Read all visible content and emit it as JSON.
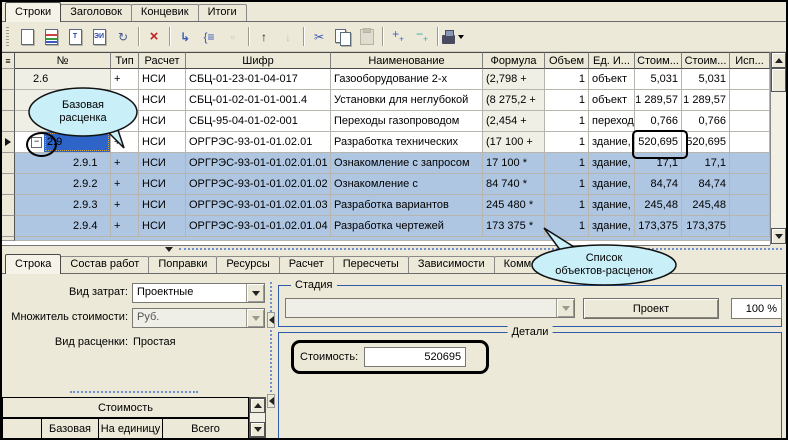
{
  "top_tabs": {
    "active_index": 0,
    "items": [
      {
        "label": "Строки"
      },
      {
        "label": "Заголовок"
      },
      {
        "label": "Концевик"
      },
      {
        "label": "Итоги"
      }
    ]
  },
  "toolbar": {
    "buttons": [
      {
        "kind": "page",
        "name": "add-line-button",
        "icon": "new-page-icon"
      },
      {
        "kind": "page-color",
        "name": "add-line-copy-button",
        "icon": "new-page-color-icon"
      },
      {
        "kind": "page",
        "label": "Т",
        "name": "add-title-line-button",
        "icon": "page-title-icon"
      },
      {
        "kind": "page",
        "label": "ЭИ",
        "name": "add-nsi-line-button",
        "icon": "page-nsi-icon"
      },
      {
        "kind": "glyph",
        "glyph": "↻",
        "color": "#44588c",
        "name": "renumber-lines-button",
        "icon": "renumber-icon"
      },
      {
        "kind": "divider"
      },
      {
        "kind": "glyph",
        "glyph": "×",
        "color": "#c22222",
        "bold": true,
        "size": 15,
        "name": "delete-line-button",
        "icon": "red-x-icon"
      },
      {
        "kind": "divider"
      },
      {
        "kind": "glyph",
        "glyph": "↳",
        "color": "#3a58b8",
        "bold": true,
        "name": "add-sub-lines-button",
        "icon": "sub-lines-icon"
      },
      {
        "kind": "glyph",
        "glyph": "{≡",
        "color": "#3a58b8",
        "name": "group-lines-button",
        "icon": "brace-group-icon"
      },
      {
        "kind": "glyph",
        "glyph": "▫",
        "color": "#a8a8a0",
        "disabled": true,
        "name": "ungroup-lines-button",
        "icon": "ungroup-icon"
      },
      {
        "kind": "divider"
      },
      {
        "kind": "glyph",
        "glyph": "↑",
        "color": "#222222",
        "bold": true,
        "name": "move-line-up-button",
        "icon": "arrow-up-icon"
      },
      {
        "kind": "glyph",
        "glyph": "↓",
        "color": "#9aa4b8",
        "bold": true,
        "disabled": true,
        "name": "move-line-down-button",
        "icon": "arrow-down-icon"
      },
      {
        "kind": "divider"
      },
      {
        "kind": "glyph",
        "glyph": "✂",
        "color": "#3a58b8",
        "name": "cut-button",
        "icon": "scissors-icon"
      },
      {
        "kind": "copy",
        "name": "copy-button",
        "icon": "copy-pages-icon"
      },
      {
        "kind": "paste",
        "disabled": true,
        "name": "paste-button",
        "icon": "clipboard-paste-icon"
      },
      {
        "kind": "divider"
      },
      {
        "kind": "glyph2",
        "glyph": "+",
        "sub": "+",
        "color": "#3a5fd0",
        "name": "include-lines-button",
        "icon": "plus-plus-icon"
      },
      {
        "kind": "glyph2",
        "glyph": "−",
        "sub": "+",
        "color": "#2aa8a8",
        "name": "exclude-lines-button",
        "icon": "minus-plus-icon"
      },
      {
        "kind": "divider"
      },
      {
        "kind": "bucket",
        "dropdown": true,
        "name": "fill-print-button",
        "icon": "ink-bucket-icon"
      }
    ]
  },
  "grid": {
    "columns": [
      "№",
      "Тип",
      "Расчет",
      "Шифр",
      "Наименование",
      "Формула",
      "Объем",
      "Ед. И...",
      "Стоим...",
      "Стоим...",
      "Исп..."
    ],
    "rows": [
      {
        "num": "2.6",
        "type": "+",
        "calc": "НСИ",
        "code": "СБЦ-01-23-01-04-017",
        "name": "Газооборудование 2-х",
        "formula": "(2,798 +",
        "volume": "1",
        "unit": "объект",
        "cost1": "5,031",
        "cost2": "5,031",
        "usage": ""
      },
      {
        "num": "",
        "type": "",
        "calc": "НСИ",
        "code": "СБЦ-01-02-01-01-001.4",
        "name": "Установки для неглубокой",
        "formula": "(8 275,2 +",
        "volume": "1",
        "unit": "объект",
        "cost1": "1 289,57",
        "cost2": "1 289,57",
        "usage": ""
      },
      {
        "num": "",
        "type": "",
        "calc": "НСИ",
        "code": "СБЦ-95-04-01-02-001",
        "name": "Переходы газопроводом",
        "formula": "(2,454 +",
        "volume": "1",
        "unit": "переход",
        "cost1": "0,766",
        "cost2": "0,766",
        "usage": ""
      },
      {
        "num": "2.9",
        "type": "+",
        "calc": "НСИ",
        "code": "ОРГРЭС-93-01-01.02.01",
        "name": "Разработка технических",
        "formula": "(17 100 +",
        "volume": "1",
        "unit": "здание,",
        "cost1": "520,695",
        "cost2": "520,695",
        "usage": "",
        "current": true,
        "expander": "minus",
        "marker": true
      },
      {
        "num": "2.9.1",
        "type": "+",
        "calc": "НСИ",
        "code": "ОРГРЭС-93-01-01.02.01.01",
        "name": "Ознакомление с запросом",
        "formula": "17 100 *",
        "volume": "1",
        "unit": "здание,",
        "cost1": "17,1",
        "cost2": "17,1",
        "usage": "",
        "child": true
      },
      {
        "num": "2.9.2",
        "type": "+",
        "calc": "НСИ",
        "code": "ОРГРЭС-93-01-01.02.01.02",
        "name": "Ознакомление с",
        "formula": "84 740 *",
        "volume": "1",
        "unit": "здание,",
        "cost1": "84,74",
        "cost2": "84,74",
        "usage": "",
        "child": true
      },
      {
        "num": "2.9.3",
        "type": "+",
        "calc": "НСИ",
        "code": "ОРГРЭС-93-01-01.02.01.03",
        "name": "Разработка вариантов",
        "formula": "245 480 *",
        "volume": "1",
        "unit": "здание,",
        "cost1": "245,48",
        "cost2": "245,48",
        "usage": "",
        "child": true
      },
      {
        "num": "2.9.4",
        "type": "+",
        "calc": "НСИ",
        "code": "ОРГРЭС-93-01-01.02.01.04",
        "name": "Разработка чертежей",
        "formula": "173 375 *",
        "volume": "1",
        "unit": "здание,",
        "cost1": "173,375",
        "cost2": "173,375",
        "usage": "",
        "child": true
      }
    ],
    "partial_next_row": true
  },
  "callouts": {
    "base_rate": "Базовая\nрасценка",
    "object_list": "Список\nобъектов-расценок"
  },
  "bottom_tabs": {
    "active_index": 0,
    "items": [
      {
        "label": "Строка"
      },
      {
        "label": "Состав работ"
      },
      {
        "label": "Поправки"
      },
      {
        "label": "Ресурсы"
      },
      {
        "label": "Расчет"
      },
      {
        "label": "Пересчеты"
      },
      {
        "label": "Зависимости"
      },
      {
        "label": "Комментарий"
      }
    ]
  },
  "inspector": {
    "fields": {
      "cost_kind": {
        "label": "Вид затрат:",
        "value": "Проектные",
        "enabled": true
      },
      "multiplier": {
        "label": "Множитель стоимости:",
        "value": "Руб.",
        "enabled": false
      },
      "rate_kind": {
        "label": "Вид расценки:",
        "value": "Простая"
      }
    },
    "stage": {
      "title": "Стадия",
      "combo_value": "",
      "button": "Проект",
      "percent": "100 %"
    },
    "details": {
      "title": "Детали",
      "cost_label": "Стоимость:",
      "cost_value": "520695"
    },
    "cost_table": {
      "title": "Стоимость",
      "columns": [
        "Базовая",
        "На единицу",
        "Всего"
      ]
    }
  },
  "colors": {
    "chrome": "#ECE9D8",
    "selection_child": "#AEC6E2",
    "current_cell": "#2E63C8",
    "callout": "#C9EFF8",
    "group_border": "#2F5AA8",
    "green_row": "#BCDCBE"
  }
}
